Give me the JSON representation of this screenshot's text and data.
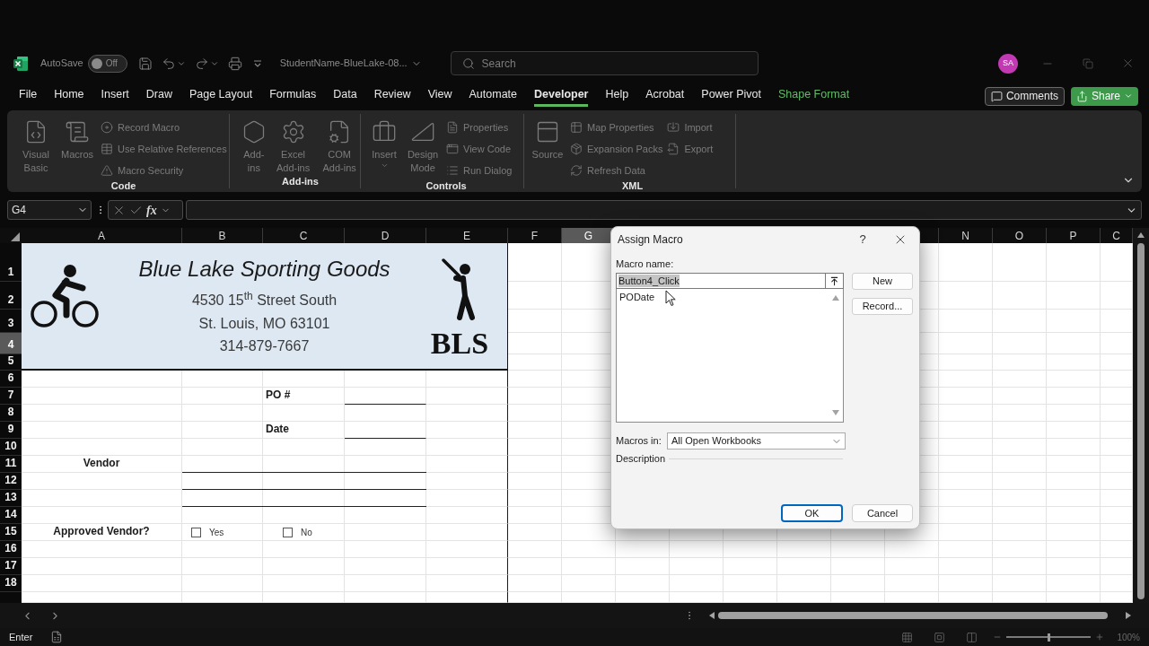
{
  "title_bar": {
    "autosave_label": "AutoSave",
    "autosave_toggle": {
      "label": "Off",
      "on": false
    },
    "file_name": "StudentName-BlueLake-08...",
    "search": {
      "placeholder": "Search"
    },
    "avatar": "SA"
  },
  "menu_tabs": [
    {
      "label": "File",
      "selected": false,
      "kind": "standard"
    },
    {
      "label": "Home",
      "selected": false,
      "kind": "standard"
    },
    {
      "label": "Insert",
      "selected": false,
      "kind": "standard"
    },
    {
      "label": "Draw",
      "selected": false,
      "kind": "standard"
    },
    {
      "label": "Page Layout",
      "selected": false,
      "kind": "standard"
    },
    {
      "label": "Formulas",
      "selected": false,
      "kind": "standard"
    },
    {
      "label": "Data",
      "selected": false,
      "kind": "standard"
    },
    {
      "label": "Review",
      "selected": false,
      "kind": "standard"
    },
    {
      "label": "View",
      "selected": false,
      "kind": "standard"
    },
    {
      "label": "Automate",
      "selected": false,
      "kind": "standard"
    },
    {
      "label": "Developer",
      "selected": true,
      "kind": "standard"
    },
    {
      "label": "Help",
      "selected": false,
      "kind": "standard"
    },
    {
      "label": "Acrobat",
      "selected": false,
      "kind": "standard"
    },
    {
      "label": "Power Pivot",
      "selected": false,
      "kind": "standard"
    },
    {
      "label": "Shape Format",
      "selected": false,
      "kind": "contextual"
    }
  ],
  "menu_buttons": {
    "comments": "Comments",
    "share": "Share"
  },
  "ribbon": {
    "disabled": true,
    "groups": [
      {
        "label": "Code",
        "items": [
          {
            "label": "Visual Basic",
            "kind": "large"
          },
          {
            "label": "Macros",
            "kind": "large"
          },
          {
            "label": "Record Macro",
            "kind": "small"
          },
          {
            "label": "Use Relative References",
            "kind": "small"
          },
          {
            "label": "Macro Security",
            "kind": "small"
          }
        ]
      },
      {
        "label": "Add-ins",
        "items": [
          {
            "label": "Add-ins",
            "kind": "large"
          },
          {
            "label": "Excel Add-ins",
            "kind": "large"
          },
          {
            "label": "COM Add-ins",
            "kind": "large"
          }
        ]
      },
      {
        "label": "Controls",
        "items": [
          {
            "label": "Insert",
            "kind": "menu"
          },
          {
            "label": "Design Mode",
            "kind": "large"
          },
          {
            "label": "Properties",
            "kind": "small"
          },
          {
            "label": "View Code",
            "kind": "small"
          },
          {
            "label": "Run Dialog",
            "kind": "small"
          }
        ]
      },
      {
        "label": "XML",
        "items": [
          {
            "label": "Source",
            "kind": "large"
          },
          {
            "label": "Map Properties",
            "kind": "small"
          },
          {
            "label": "Expansion Packs",
            "kind": "small"
          },
          {
            "label": "Refresh Data",
            "kind": "small"
          },
          {
            "label": "Import",
            "kind": "small"
          },
          {
            "label": "Export",
            "kind": "small"
          }
        ]
      }
    ]
  },
  "formula_bar": {
    "name_box": "G4",
    "function_label": "fx"
  },
  "sheet": {
    "columns_left": [
      {
        "label": "A",
        "selected": false
      },
      {
        "label": "B",
        "selected": false
      },
      {
        "label": "C",
        "selected": false
      },
      {
        "label": "D",
        "selected": false
      },
      {
        "label": "E",
        "selected": false
      },
      {
        "label": "F",
        "selected": false
      },
      {
        "label": "G",
        "selected": true
      }
    ],
    "columns_right": [
      {
        "label": "N",
        "selected": false
      },
      {
        "label": "O",
        "selected": false
      },
      {
        "label": "P",
        "selected": false
      },
      {
        "label": "C",
        "selected": false
      }
    ],
    "rows": [
      {
        "label": "1",
        "selected": false
      },
      {
        "label": "2",
        "selected": false
      },
      {
        "label": "3",
        "selected": false
      },
      {
        "label": "4",
        "selected": true
      },
      {
        "label": "5",
        "selected": false
      },
      {
        "label": "6",
        "selected": false
      },
      {
        "label": "7",
        "selected": false
      },
      {
        "label": "8",
        "selected": false
      },
      {
        "label": "9",
        "selected": false
      },
      {
        "label": "10",
        "selected": false
      },
      {
        "label": "11",
        "selected": false
      },
      {
        "label": "12",
        "selected": false
      },
      {
        "label": "13",
        "selected": false
      },
      {
        "label": "14",
        "selected": false
      },
      {
        "label": "15",
        "selected": false
      },
      {
        "label": "16",
        "selected": false
      },
      {
        "label": "17",
        "selected": false
      },
      {
        "label": "18",
        "selected": false
      }
    ],
    "letterhead": {
      "company": "Blue Lake Sporting Goods",
      "street": "4530 15$^{th}$ Street South",
      "city": "St. Louis, MO 63101",
      "phone": "314-879-7667",
      "logo_text": "BLS"
    },
    "po_label": "PO #",
    "date_label": "Date",
    "vendor_label": "Vendor",
    "approved_label": "Approved Vendor?",
    "approved_options": [
      {
        "label": "Yes",
        "checked": false
      },
      {
        "label": "No",
        "checked": false
      }
    ]
  },
  "dialog": {
    "title": "Assign Macro",
    "help": "?",
    "macro_name_label": "Macro name:",
    "macro_name": {
      "value": "Button4_Click",
      "text_selected": true
    },
    "macros": [
      {
        "label": "PODate",
        "selected": false
      }
    ],
    "side_buttons": [
      "New",
      "Record..."
    ],
    "macros_in_label": "Macros in:",
    "macros_in": "All Open Workbooks",
    "description_label": "Description",
    "footer_buttons": [
      {
        "label": "OK",
        "focused": true
      },
      {
        "label": "Cancel",
        "focused": false
      }
    ]
  },
  "status_bar": {
    "mode": "Enter",
    "zoom_slider": {
      "level": 0.5
    },
    "zoom": "100%"
  }
}
